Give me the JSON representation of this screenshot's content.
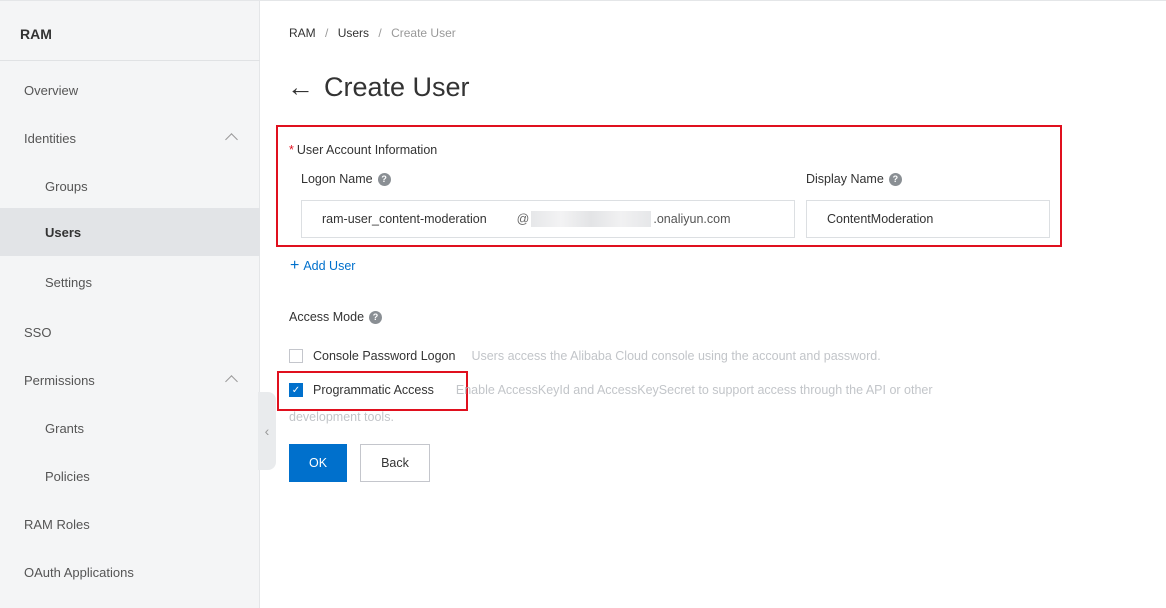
{
  "sidebar": {
    "title": "RAM",
    "items": [
      {
        "label": "Overview"
      },
      {
        "label": "Identities"
      },
      {
        "label": "Groups"
      },
      {
        "label": "Users"
      },
      {
        "label": "Settings"
      },
      {
        "label": "SSO"
      },
      {
        "label": "Permissions"
      },
      {
        "label": "Grants"
      },
      {
        "label": "Policies"
      },
      {
        "label": "RAM Roles"
      },
      {
        "label": "OAuth Applications"
      }
    ],
    "collapse_icon": "chevron-left-icon"
  },
  "breadcrumb": {
    "items": [
      "RAM",
      "Users",
      "Create User"
    ],
    "separator": "/"
  },
  "page": {
    "back_arrow": "←",
    "title": "Create User"
  },
  "form": {
    "required_mark": "*",
    "section_label": "User Account Information",
    "logon_name_label": "Logon Name",
    "display_name_label": "Display Name",
    "help_glyph": "?",
    "logon_name_value": "ram-user_content-moderation",
    "logon_at": "@",
    "logon_domain_suffix": ".onaliyun.com",
    "display_name_value": "ContentModeration",
    "add_user_plus": "+",
    "add_user_label": "Add User",
    "access_mode_label": "Access Mode",
    "console_logon_label": "Console Password Logon",
    "console_logon_desc": "Users access the Alibaba Cloud console using the account and password.",
    "console_logon_checked": false,
    "programmatic_label": "Programmatic Access",
    "programmatic_desc_line1": "Enable AccessKeyId and AccessKeySecret to support access through the API or other",
    "programmatic_desc_line2": "development tools.",
    "programmatic_checked": true,
    "check_glyph": "✓"
  },
  "buttons": {
    "ok": "OK",
    "back": "Back"
  },
  "colors": {
    "accent": "#0070cc",
    "highlight": "#e0101e",
    "sidebar_bg": "#f4f5f6",
    "active_item_bg": "#e2e4e7"
  }
}
